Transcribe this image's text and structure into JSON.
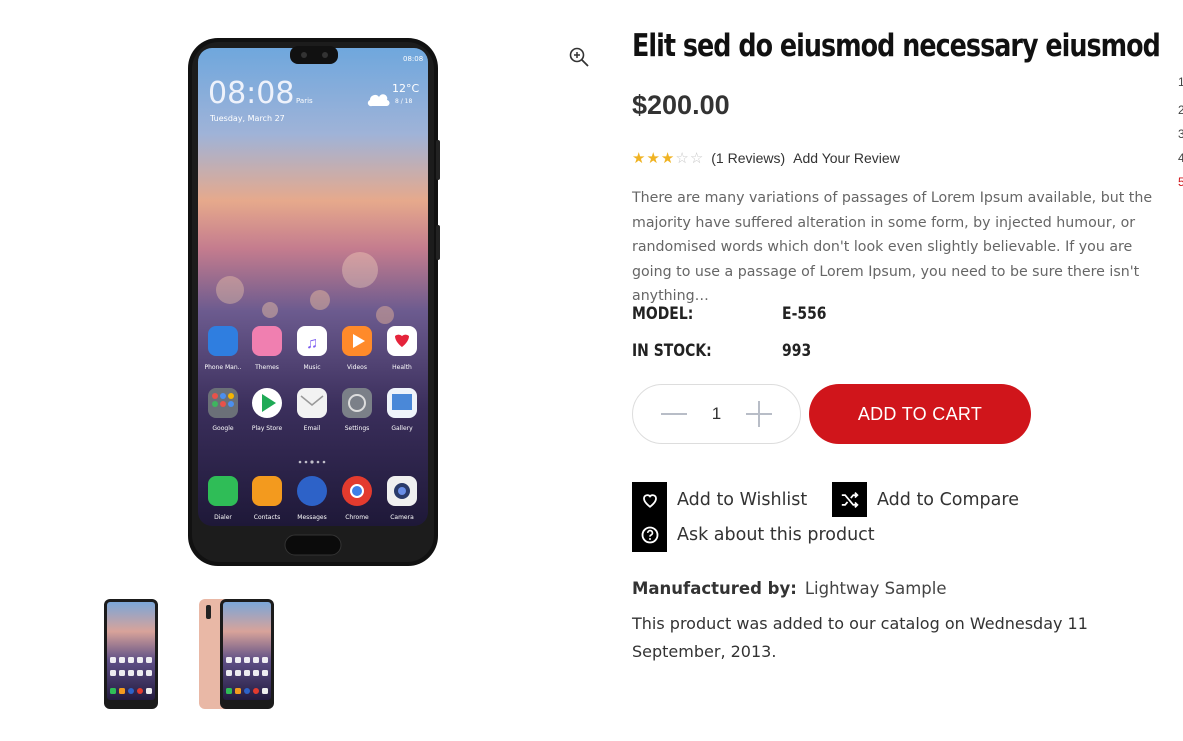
{
  "product": {
    "title": "Elit sed do eiusmod necessary eiusmod",
    "price": "$200.00",
    "rating": 3,
    "rating_max": 5,
    "reviews_text": "(1  Reviews)",
    "add_review": "Add Your Review",
    "description": "There are many variations of passages of Lorem Ipsum available, but the majority have suffered alteration in some form, by injected humour, or randomised words which don't look even slightly believable. If you are going to use a passage of Lorem Ipsum, you need to be sure there isn't anything…",
    "specs": [
      {
        "label": "MODEL:",
        "value": "E-556"
      },
      {
        "label": "IN STOCK:",
        "value": "993"
      }
    ],
    "quantity": "1",
    "add_to_cart": "ADD TO CART",
    "wishlist": "Add to Wishlist",
    "compare": "Add to Compare",
    "ask": "Ask about this product",
    "manufactured_label": "Manufactured by:",
    "manufacturer": "Lightway Sample",
    "added_text": "This product was added to our catalog on Wednesday 11 September, 2013."
  },
  "phone_screen": {
    "time": "08:08",
    "city": "Paris",
    "date": "Tuesday, March 27",
    "temp": "12°C",
    "temp_range": "8 / 18",
    "status_time": "08:08",
    "apps_row1": [
      "Phone Man..",
      "Themes",
      "Music",
      "Videos",
      "Health"
    ],
    "apps_row2": [
      "Google",
      "Play Store",
      "Email",
      "Settings",
      "Gallery"
    ],
    "dock": [
      "Dialer",
      "Contacts",
      "Messages",
      "Chrome",
      "Camera"
    ]
  },
  "edge_numbers": [
    "1",
    "2",
    "3",
    "4",
    "5"
  ],
  "colors": {
    "accent": "#d0151b",
    "star": "#f0b323",
    "text": "#333333"
  }
}
